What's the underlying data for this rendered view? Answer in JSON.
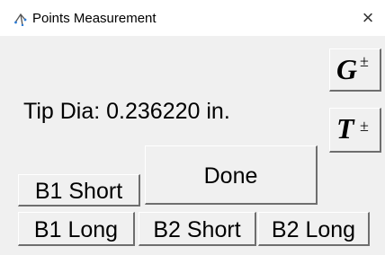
{
  "window": {
    "title": "Points Measurement",
    "close_glyph": "×"
  },
  "measurement": {
    "tip_dia_text": "Tip Dia: 0.236220 in."
  },
  "symbols": {
    "g_letter": "G",
    "t_letter": "T",
    "pm": "±"
  },
  "buttons": {
    "done": "Done",
    "b1_short": "B1 Short",
    "b1_long": "B1 Long",
    "b2_short": "B2 Short",
    "b2_long": "B2 Long"
  }
}
